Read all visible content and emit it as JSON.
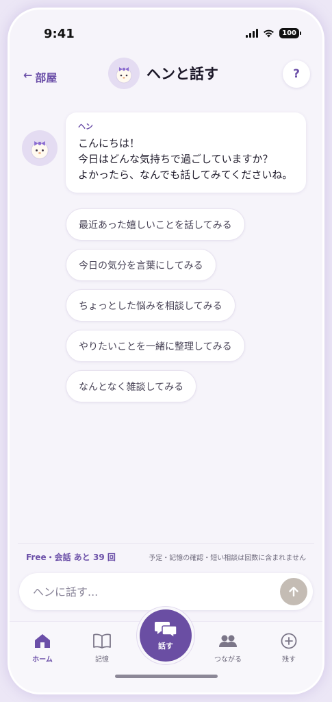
{
  "status_bar": {
    "time": "9:41",
    "battery": "100"
  },
  "header": {
    "back_label": "部屋",
    "title": "ヘンと話す",
    "help": "?"
  },
  "message": {
    "sender": "ヘン",
    "lines": [
      "こんにちは！",
      "今日はどんな気持ちで過ごしていますか？",
      "よかったら、なんでも話してみてくださいね。"
    ]
  },
  "suggestions": [
    "最近あった嬉しいことを話してみる",
    "今日の気分を言葉にしてみる",
    "ちょっとした悩みを相談してみる",
    "やりたいことを一緒に整理してみる",
    "なんとなく雑談してみる"
  ],
  "quota": {
    "main": "Free・会話 あと 39 回",
    "note": "予定・記憶の確認・短い相談は回数に含まれません"
  },
  "composer": {
    "placeholder": "ヘンに話す..."
  },
  "tabs": {
    "home": "ホーム",
    "memory": "記憶",
    "talk": "話す",
    "connect": "つながる",
    "leave": "残す"
  },
  "colors": {
    "accent": "#6a4ea3",
    "background": "#f6f4fa"
  }
}
